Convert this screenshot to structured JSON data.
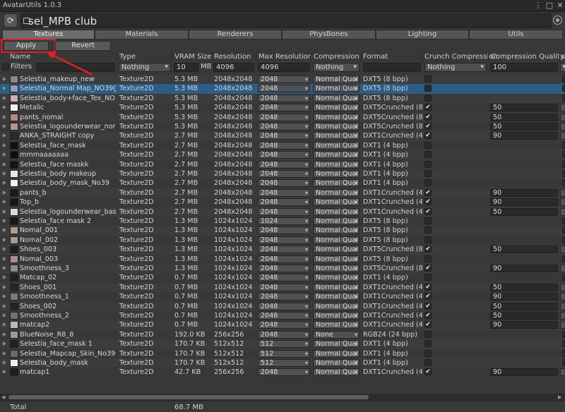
{
  "window": {
    "title": "AvatarUtils 1.0.3"
  },
  "header": {
    "object_name": "sel_MPB club"
  },
  "tabs": [
    "Textures",
    "Materials",
    "Renderers",
    "PhysBones",
    "Lighting",
    "Utils"
  ],
  "actions": {
    "apply": "Apply",
    "revert": "Revert"
  },
  "columns": {
    "name": "Name",
    "type": "Type",
    "vram": "VRAM Size",
    "resolution": "Resolution",
    "max_resolution": "Max Resolution",
    "compression": "Compression",
    "format": "Format",
    "crunch": "Crunch Compression",
    "quality": "Compression Quality",
    "extra": "s"
  },
  "filters": {
    "label": "Filters",
    "type": "Nothing",
    "vram": "10",
    "vram_unit": "MB",
    "resolution": "4096",
    "max_resolution": "4096",
    "compression": "Nothing",
    "crunch": "Nothing",
    "quality": "100"
  },
  "rows": [
    {
      "name": "Selestia_makeup_new",
      "type": "Texture2D",
      "vram": "5.3 MB",
      "res": "2048x2048",
      "max": "2048",
      "comp": "Normal Qual",
      "format": "DXT5 (8 bpp)",
      "crunch": false,
      "quality": "",
      "thumb": "#8a8a8a"
    },
    {
      "name": "Selestia_Normal Map_NO39",
      "count": "2",
      "type": "Texture2D",
      "vram": "5.3 MB",
      "res": "2048x2048",
      "max": "2048",
      "comp": "Normal Qual",
      "format": "DXT5 (8 bpp)",
      "crunch": false,
      "quality": "",
      "thumb": "#9a9ab8",
      "selected": true
    },
    {
      "name": "Selestia_body+face_Tex_NO39",
      "type": "Texture2D",
      "vram": "5.3 MB",
      "res": "2048x2048",
      "max": "2048",
      "comp": "Normal Qual",
      "format": "DXT5 (8 bpp)",
      "crunch": false,
      "quality": "",
      "thumb": "#c9b1a9"
    },
    {
      "name": "Metalic",
      "type": "Texture2D",
      "vram": "5.3 MB",
      "res": "2048x2048",
      "max": "2048",
      "comp": "Normal Qual",
      "format": "DXT5Crunched (8 b",
      "crunch": true,
      "quality": "50",
      "thumb": "#f0f0f0"
    },
    {
      "name": "pants_nomal",
      "type": "Texture2D",
      "vram": "5.3 MB",
      "res": "2048x2048",
      "max": "2048",
      "comp": "Normal Qual",
      "format": "DXT5Crunched (8 b",
      "crunch": true,
      "quality": "50",
      "thumb": "#b08a86"
    },
    {
      "name": "Selestia_logounderwear_normal",
      "type": "Texture2D",
      "vram": "5.3 MB",
      "res": "2048x2048",
      "max": "2048",
      "comp": "Normal Qual",
      "format": "DXT5Crunched (8 b",
      "crunch": true,
      "quality": "50",
      "thumb": "#b59590"
    },
    {
      "name": "ANKA_STRAIGHT copy",
      "type": "Texture2D",
      "vram": "2.7 MB",
      "res": "2048x2048",
      "max": "2048",
      "comp": "Normal Qual",
      "format": "DXT1Crunched (4 b",
      "crunch": true,
      "quality": "90",
      "thumb": "#2a2a2a"
    },
    {
      "name": "Selestia_face_mask",
      "type": "Texture2D",
      "vram": "2.7 MB",
      "res": "2048x2048",
      "max": "2048",
      "comp": "Normal Qual",
      "format": "DXT1 (4 bpp)",
      "crunch": false,
      "quality": "",
      "thumb": "#111111"
    },
    {
      "name": "mmmaaaaaaa",
      "type": "Texture2D",
      "vram": "2.7 MB",
      "res": "2048x2048",
      "max": "2048",
      "comp": "Normal Qual",
      "format": "DXT1 (4 bpp)",
      "crunch": false,
      "quality": "",
      "thumb": "#0d0d0d"
    },
    {
      "name": "Selestia_face maskk",
      "type": "Texture2D",
      "vram": "2.7 MB",
      "res": "2048x2048",
      "max": "2048",
      "comp": "Normal Qual",
      "format": "DXT1 (4 bpp)",
      "crunch": false,
      "quality": "",
      "thumb": "#141414"
    },
    {
      "name": "Selestia_body makeup",
      "type": "Texture2D",
      "vram": "2.7 MB",
      "res": "2048x2048",
      "max": "2048",
      "comp": "Normal Qual",
      "format": "DXT1 (4 bpp)",
      "crunch": false,
      "quality": "",
      "thumb": "#e8e8e8"
    },
    {
      "name": "Selestia_body_mask_No39",
      "type": "Texture2D",
      "vram": "2.7 MB",
      "res": "2048x2048",
      "max": "2048",
      "comp": "Normal Qual",
      "format": "DXT1 (4 bpp)",
      "crunch": false,
      "quality": "",
      "thumb": "#f2f2f2"
    },
    {
      "name": "pants_b",
      "type": "Texture2D",
      "vram": "2.7 MB",
      "res": "2048x2048",
      "max": "2048",
      "comp": "Normal Qual",
      "format": "DXT1Crunched (4 b",
      "crunch": true,
      "quality": "90",
      "thumb": "#1a1a1a"
    },
    {
      "name": "Top_b",
      "type": "Texture2D",
      "vram": "2.7 MB",
      "res": "2048x2048",
      "max": "2048",
      "comp": "Normal Qual",
      "format": "DXT1Crunched (4 b",
      "crunch": true,
      "quality": "90",
      "thumb": "#161616"
    },
    {
      "name": "Selestia_logounderwear_base",
      "type": "Texture2D",
      "vram": "2.7 MB",
      "res": "2048x2048",
      "max": "2048",
      "comp": "Normal Qual",
      "format": "DXT1Crunched (4 b",
      "crunch": true,
      "quality": "50",
      "thumb": "#dcdcdc"
    },
    {
      "name": "Selestia_face mask 2",
      "type": "Texture2D",
      "vram": "1.3 MB",
      "res": "1024x1024",
      "max": "1024",
      "comp": "Normal Qual",
      "format": "DXT5 (8 bpp)",
      "crunch": false,
      "quality": "",
      "thumb": "#181818"
    },
    {
      "name": "Nomal_001",
      "type": "Texture2D",
      "vram": "1.3 MB",
      "res": "1024x1024",
      "max": "2048",
      "comp": "Normal Qual",
      "format": "DXT5 (8 bpp)",
      "crunch": false,
      "quality": "",
      "thumb": "#b49994"
    },
    {
      "name": "Nomal_002",
      "type": "Texture2D",
      "vram": "1.3 MB",
      "res": "1024x1024",
      "max": "2048",
      "comp": "Normal Qual",
      "format": "DXT5 (8 bpp)",
      "crunch": false,
      "quality": "",
      "thumb": "#b09590"
    },
    {
      "name": "Shoes_003",
      "type": "Texture2D",
      "vram": "1.3 MB",
      "res": "1024x1024",
      "max": "2048",
      "comp": "Normal Qual",
      "format": "DXT5Crunched (8 b",
      "crunch": true,
      "quality": "50",
      "thumb": "#1c1c1c"
    },
    {
      "name": "Nomal_003",
      "type": "Texture2D",
      "vram": "1.3 MB",
      "res": "1024x1024",
      "max": "2048",
      "comp": "Normal Qual",
      "format": "DXT5 (8 bpp)",
      "crunch": false,
      "quality": "",
      "thumb": "#a8908c"
    },
    {
      "name": "Smoothness_3",
      "type": "Texture2D",
      "vram": "1.3 MB",
      "res": "1024x1024",
      "max": "2048",
      "comp": "Normal Qual",
      "format": "DXT5Crunched (8 b",
      "crunch": true,
      "quality": "90",
      "thumb": "#8c8c8c"
    },
    {
      "name": "Matcap_02",
      "type": "Texture2D",
      "vram": "0.7 MB",
      "res": "1024x1024",
      "max": "2048",
      "comp": "Normal Qual",
      "format": "DXT1 (4 bpp)",
      "crunch": false,
      "quality": "",
      "thumb": "#202020"
    },
    {
      "name": "Shoes_001",
      "type": "Texture2D",
      "vram": "0.7 MB",
      "res": "1024x1024",
      "max": "2048",
      "comp": "Normal Qual",
      "format": "DXT1Crunched (4 b",
      "crunch": true,
      "quality": "50",
      "thumb": "#262626"
    },
    {
      "name": "Smoothness_1",
      "type": "Texture2D",
      "vram": "0.7 MB",
      "res": "1024x1024",
      "max": "2048",
      "comp": "Normal Qual",
      "format": "DXT1Crunched (4 b",
      "crunch": true,
      "quality": "90",
      "thumb": "#7c7c7c"
    },
    {
      "name": "Shoes_002",
      "type": "Texture2D",
      "vram": "0.7 MB",
      "res": "1024x1024",
      "max": "2048",
      "comp": "Normal Qual",
      "format": "DXT1Crunched (4 b",
      "crunch": true,
      "quality": "50",
      "thumb": "#242424"
    },
    {
      "name": "Smoothness_2",
      "type": "Texture2D",
      "vram": "0.7 MB",
      "res": "1024x1024",
      "max": "2048",
      "comp": "Normal Qual",
      "format": "DXT1Crunched (4 b",
      "crunch": true,
      "quality": "50",
      "thumb": "#707070"
    },
    {
      "name": "matcap2",
      "type": "Texture2D",
      "vram": "0.7 MB",
      "res": "1024x1024",
      "max": "2048",
      "comp": "Normal Qual",
      "format": "DXT1Crunched (4 b",
      "crunch": true,
      "quality": "90",
      "thumb": "#b9b9b9"
    },
    {
      "name": "BlueNoise_R8_8",
      "type": "Texture2D",
      "vram": "192.0 KB",
      "res": "256x256",
      "max": "2048",
      "comp": "None",
      "format": "RGB24 (24 bpp)",
      "crunch": false,
      "quality": "",
      "thumb": "#9a9a9a"
    },
    {
      "name": "Selestia_face_mask 1",
      "type": "Texture2D",
      "vram": "170.7 KB",
      "res": "512x512",
      "max": "512",
      "comp": "Normal Qual",
      "format": "DXT1 (4 bpp)",
      "crunch": false,
      "quality": "",
      "thumb": "#222222"
    },
    {
      "name": "Selestia_Mapcap_Skin_No39",
      "count": "1",
      "type": "Texture2D",
      "vram": "170.7 KB",
      "res": "512x512",
      "max": "512",
      "comp": "Normal Qual",
      "format": "DXT1 (4 bpp)",
      "crunch": false,
      "quality": "",
      "thumb": "#6a6a6a"
    },
    {
      "name": "Selestia_body_mask",
      "type": "Texture2D",
      "vram": "170.7 KB",
      "res": "512x512",
      "max": "512",
      "comp": "Normal Qual",
      "format": "DXT1 (4 bpp)",
      "crunch": false,
      "quality": "",
      "thumb": "#f0f0f0"
    },
    {
      "name": "matcap1",
      "type": "Texture2D",
      "vram": "42.7 KB",
      "res": "256x256",
      "max": "2048",
      "comp": "Normal Qual",
      "format": "DXT1Crunched (4 b",
      "crunch": true,
      "quality": "90",
      "thumb": "#1e1e1e"
    }
  ],
  "footer": {
    "total_label": "Total",
    "total_value": "68.7 MB"
  },
  "colors": {
    "selected_row": "#2c5d87",
    "highlight": "#d92027",
    "background": "#383838"
  }
}
